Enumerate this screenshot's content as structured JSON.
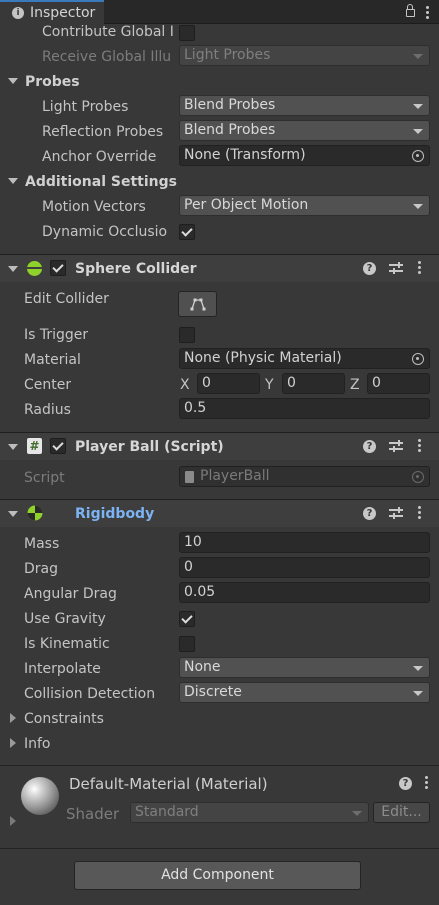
{
  "tab": {
    "title": "Inspector"
  },
  "lighting": {
    "contribute_gi_label": "Contribute Global I",
    "receive_gi_label": "Receive Global Illu",
    "receive_gi_value": "Light Probes"
  },
  "probes": {
    "title": "Probes",
    "light_probes_label": "Light Probes",
    "light_probes_value": "Blend Probes",
    "reflection_probes_label": "Reflection Probes",
    "reflection_probes_value": "Blend Probes",
    "anchor_override_label": "Anchor Override",
    "anchor_override_value": "None (Transform)"
  },
  "additional": {
    "title": "Additional Settings",
    "motion_vectors_label": "Motion Vectors",
    "motion_vectors_value": "Per Object Motion",
    "dynamic_occlusion_label": "Dynamic Occlusio"
  },
  "sphere_collider": {
    "title": "Sphere Collider",
    "edit_collider_label": "Edit Collider",
    "is_trigger_label": "Is Trigger",
    "material_label": "Material",
    "material_value": "None (Physic Material)",
    "center_label": "Center",
    "center_x_label": "X",
    "center_x": "0",
    "center_y_label": "Y",
    "center_y": "0",
    "center_z_label": "Z",
    "center_z": "0",
    "radius_label": "Radius",
    "radius_value": "0.5"
  },
  "player_ball": {
    "title": "Player Ball (Script)",
    "script_label": "Script",
    "script_value": "PlayerBall"
  },
  "rigidbody": {
    "title": "Rigidbody",
    "mass_label": "Mass",
    "mass_value": "10",
    "drag_label": "Drag",
    "drag_value": "0",
    "angular_drag_label": "Angular Drag",
    "angular_drag_value": "0.05",
    "use_gravity_label": "Use Gravity",
    "is_kinematic_label": "Is Kinematic",
    "interpolate_label": "Interpolate",
    "interpolate_value": "None",
    "collision_label": "Collision Detection",
    "collision_value": "Discrete",
    "constraints_label": "Constraints",
    "info_label": "Info"
  },
  "material": {
    "title": "Default-Material (Material)",
    "shader_label": "Shader",
    "shader_value": "Standard",
    "edit_label": "Edit..."
  },
  "add_component_label": "Add Component",
  "colors": {
    "background": "#383838",
    "header": "#3e3e3e",
    "field": "#2a2a2a",
    "accent_link": "#7cb3f2",
    "collider_green": "#8fd32a"
  }
}
